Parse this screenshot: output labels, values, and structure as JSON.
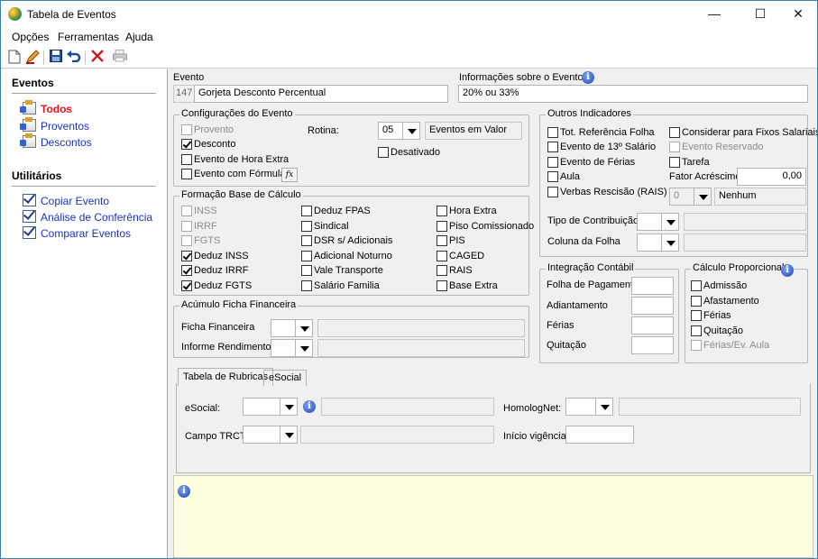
{
  "window": {
    "title": "Tabela de Eventos",
    "minimize": "—",
    "maximize": "☐",
    "close": "✕"
  },
  "menu": [
    "Opções",
    "Ferramentas",
    "Ajuda"
  ],
  "toolbar": {
    "icons": [
      "new-icon",
      "edit-icon",
      "save-icon",
      "undo-icon",
      "delete-icon",
      "print-icon"
    ]
  },
  "sidebar": {
    "eventos_heading": "Eventos",
    "eventos": [
      {
        "label": "Todos",
        "active": true
      },
      {
        "label": "Proventos"
      },
      {
        "label": "Descontos"
      }
    ],
    "utilitarios_heading": "Utilitários",
    "utilitarios": [
      {
        "label": "Copiar Evento"
      },
      {
        "label": "Análise de Conferência"
      },
      {
        "label": "Comparar Eventos"
      }
    ]
  },
  "evento": {
    "label": "Evento",
    "code": "147",
    "name": "Gorjeta Desconto Percentual"
  },
  "info_evento": {
    "label": "Informações sobre o Evento",
    "value": "20% ou 33%"
  },
  "config": {
    "caption": "Configurações do Evento",
    "provento": "Provento",
    "desconto": "Desconto",
    "hora_extra": "Evento de Hora Extra",
    "formula": "Evento com Fórmula",
    "formula_btn": "fx",
    "rotina_label": "Rotina:",
    "rotina_value": "05",
    "rotina_desc": "Eventos em Valor",
    "desativado": "Desativado"
  },
  "formacao": {
    "caption": "Formação Base de Cálculo",
    "col1": [
      {
        "label": "INSS",
        "checked": false,
        "disabled": true
      },
      {
        "label": "IRRF",
        "checked": false,
        "disabled": true
      },
      {
        "label": "FGTS",
        "checked": false,
        "disabled": true
      },
      {
        "label": "Deduz INSS",
        "checked": true
      },
      {
        "label": "Deduz IRRF",
        "checked": true
      },
      {
        "label": "Deduz FGTS",
        "checked": true
      }
    ],
    "col2": [
      {
        "label": "Deduz FPAS"
      },
      {
        "label": "Sindical"
      },
      {
        "label": "DSR s/ Adicionais"
      },
      {
        "label": "Adicional Noturno"
      },
      {
        "label": "Vale Transporte"
      },
      {
        "label": "Salário Familia"
      }
    ],
    "col3": [
      {
        "label": "Hora Extra"
      },
      {
        "label": "Piso Comissionado"
      },
      {
        "label": "PIS"
      },
      {
        "label": "CAGED"
      },
      {
        "label": "RAIS"
      },
      {
        "label": "Base Extra"
      }
    ]
  },
  "acumulo": {
    "caption": "Acúmulo Ficha Financeira",
    "ficha": "Ficha Financeira",
    "informe": "Informe Rendimentos"
  },
  "outros": {
    "caption": "Outros Indicadores",
    "left": [
      {
        "label": "Tot. Referência Folha"
      },
      {
        "label": "Evento de 13º Salário"
      },
      {
        "label": "Evento de Férias"
      },
      {
        "label": "Aula"
      },
      {
        "label": "Verbas Rescisão (RAIS)"
      }
    ],
    "right": [
      {
        "label": "Considerar para Fixos Salariais",
        "disabled": false
      },
      {
        "label": "Evento Reservado",
        "disabled": true
      },
      {
        "label": "Tarefa",
        "disabled": false
      }
    ],
    "fator_label": "Fator Acréscimo",
    "fator_value": "0,00",
    "verbas_value": "0",
    "verbas_desc": "Nenhum",
    "tipo_label": "Tipo de Contribuição",
    "coluna_label": "Coluna da Folha"
  },
  "integracao": {
    "caption": "Integração Contábil",
    "items": [
      "Folha de Pagamento",
      "Adiantamento",
      "Férias",
      "Quitação"
    ]
  },
  "calculo": {
    "caption": "Cálculo Proporcional",
    "items": [
      {
        "label": "Admissão"
      },
      {
        "label": "Afastamento"
      },
      {
        "label": "Férias"
      },
      {
        "label": "Quitação"
      },
      {
        "label": "Férias/Ev. Aula",
        "disabled": true
      }
    ]
  },
  "tabs": [
    {
      "label": "Tabela de Rubricas",
      "active": true
    },
    {
      "label": "eSocial"
    }
  ],
  "rubricas": {
    "esocial": "eSocial:",
    "homolognet": "HomologNet:",
    "campo_trct": "Campo TRCT:",
    "inicio": "Início vigência:"
  }
}
